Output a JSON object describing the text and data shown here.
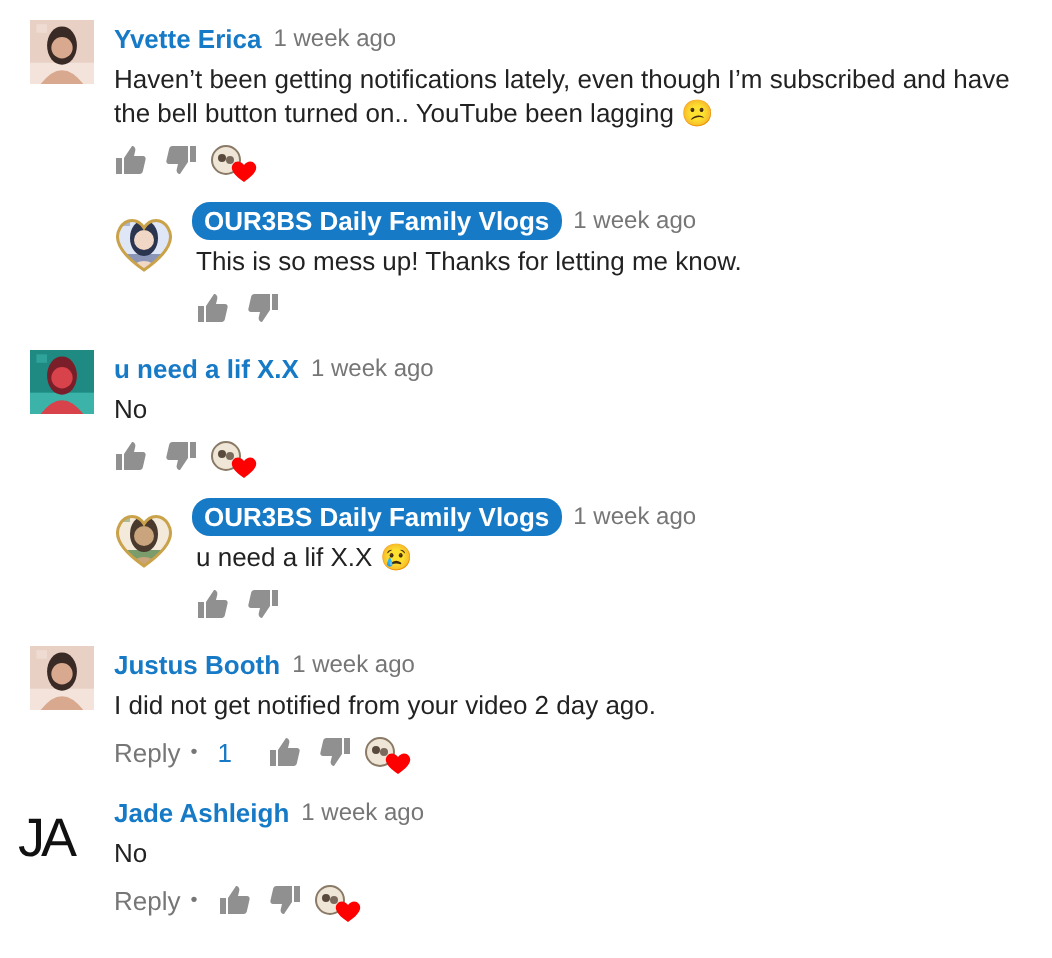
{
  "comments": [
    {
      "author": "Yvette Erica",
      "owner": false,
      "time": "1 week ago",
      "body": "Haven’t been getting notifications lately, even though I’m subscribed and have the bell button turned on.. YouTube been lagging 😕",
      "hearted": true,
      "replies": [
        {
          "author": "OUR3BS Daily Family Vlogs",
          "owner": true,
          "time": "1 week ago",
          "body": "This is so mess up! Thanks for letting me know.",
          "hearted": false
        }
      ]
    },
    {
      "author": "u need a lif X.X",
      "owner": false,
      "time": "1 week ago",
      "body": "No",
      "hearted": true,
      "replies": [
        {
          "author": "OUR3BS Daily Family Vlogs",
          "owner": true,
          "time": "1 week ago",
          "body": "u need a lif X.X 😢",
          "hearted": false
        }
      ]
    },
    {
      "author": "Justus Booth",
      "owner": false,
      "time": "1 week ago",
      "body": "I did not get notified from your video 2 day ago.",
      "reply_label": "Reply",
      "separator": "•",
      "likes": "1",
      "hearted": true
    },
    {
      "author": "Jade Ashleigh",
      "owner": false,
      "time": "1 week ago",
      "avatar": {
        "kind": "initials",
        "text": "JA"
      },
      "body": "No",
      "reply_label": "Reply",
      "separator": "•",
      "hearted": true
    }
  ]
}
